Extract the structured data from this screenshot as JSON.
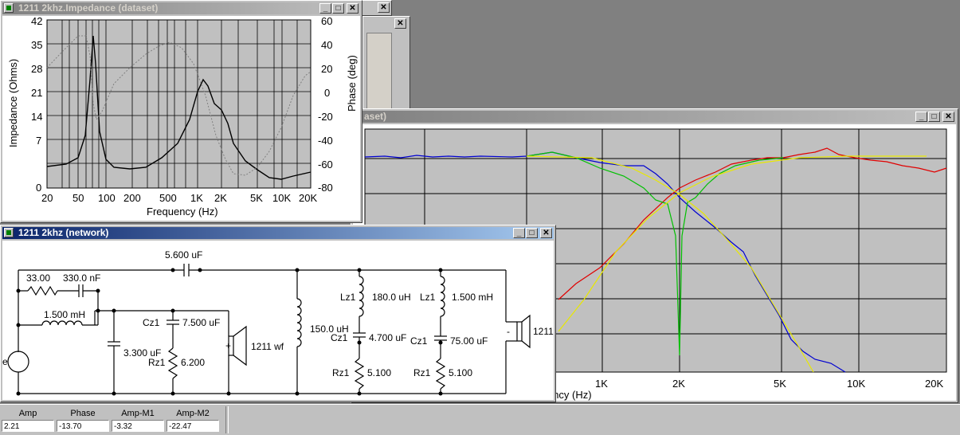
{
  "bg_windows": {
    "close": "✕"
  },
  "response_window": {
    "title": "aset)",
    "x_axis": {
      "label": "Frequency (Hz)",
      "ticks": [
        "1K",
        "2K",
        "5K",
        "10K",
        "20K"
      ]
    }
  },
  "impedance_window": {
    "title": "1211 2khz.Impedance (dataset)",
    "left_axis": {
      "label": "Impedance (Ohms)",
      "ticks": [
        "42",
        "35",
        "28",
        "21",
        "14",
        "7",
        "0"
      ]
    },
    "right_axis": {
      "label": "Phase (deg)",
      "ticks": [
        "60",
        "40",
        "20",
        "0",
        "-20",
        "-40",
        "-60",
        "-80"
      ]
    },
    "x_axis": {
      "label": "Frequency (Hz)",
      "ticks": [
        "20",
        "50",
        "100",
        "200",
        "500",
        "1K",
        "2K",
        "5K",
        "10K",
        "20K"
      ]
    }
  },
  "network_window": {
    "title": "1211 2khz (network)",
    "components": {
      "c_top": "5.600 uF",
      "r_series": "33.00",
      "c_series": "330.0 nF",
      "l_series": "1.500 mH",
      "c_shunt": "3.300 uF",
      "cz1_a_label": "Cz1",
      "cz1_a": "7.500 uF",
      "rz1_a_label": "Rz1",
      "rz1_a": "6.200",
      "woofer": "1211 wf",
      "l_shunt": "150.0 uH",
      "lz1_b_label": "Lz1",
      "lz1_b": "180.0 uH",
      "cz1_b_label": "Cz1",
      "cz1_b": "4.700 uF",
      "rz1_b_label": "Rz1",
      "rz1_b": "5.100",
      "lz1_c_label": "Lz1",
      "lz1_c": "1.500 mH",
      "cz1_c_label": "Cz1",
      "cz1_c": "75.00 uF",
      "rz1_c_label": "Rz1",
      "rz1_c": "5.100",
      "tweeter": "1211",
      "source_label": "e",
      "plus": "+",
      "minus": "-"
    }
  },
  "window_buttons": {
    "min": "_",
    "max": "□",
    "close": "✕"
  },
  "status_bar": {
    "fields": [
      {
        "label": "Amp",
        "value": "2.21"
      },
      {
        "label": "Phase",
        "value": "-13.70"
      },
      {
        "label": "Amp-M1",
        "value": "-3.32"
      },
      {
        "label": "Amp-M2",
        "value": "-22.47"
      }
    ]
  },
  "colors": {
    "impedance": "#000000",
    "phase": "#808080",
    "red": "#e00000",
    "blue": "#0000d0",
    "green": "#00c000",
    "yellow": "#e8e800",
    "plot_bg": "#c0c0c0",
    "grid": "#000000"
  }
}
